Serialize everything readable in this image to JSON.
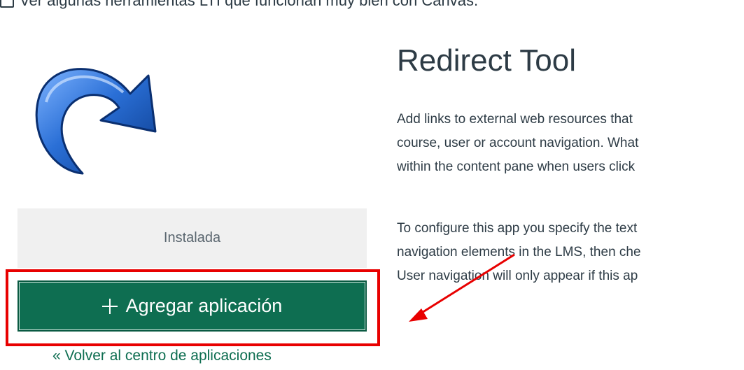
{
  "top_line": {
    "label": "Ver algunas herramientas LTI que funcionan muy bien con Canvas."
  },
  "app": {
    "icon": "redirect-arrow-icon",
    "installed_label": "Instalada",
    "add_button_label": "Agregar aplicación",
    "add_button_icon": "plus-icon",
    "back_link_label": "« Volver al centro de aplicaciones"
  },
  "tool": {
    "title": "Redirect Tool",
    "paragraph_1": [
      "Add links to external web resources that",
      "course, user or account navigation. What",
      "within the content pane when users click"
    ],
    "paragraph_2": [
      "To configure this app you specify the text",
      "navigation elements in the LMS, then che",
      "User navigation will only appear if this ap"
    ]
  },
  "annotation": {
    "highlight_color": "#e80000",
    "arrow_color": "#e80000"
  },
  "colors": {
    "primary_button": "#0e6e51",
    "installed_bg": "#f0f0f0",
    "text": "#2d3b45"
  }
}
